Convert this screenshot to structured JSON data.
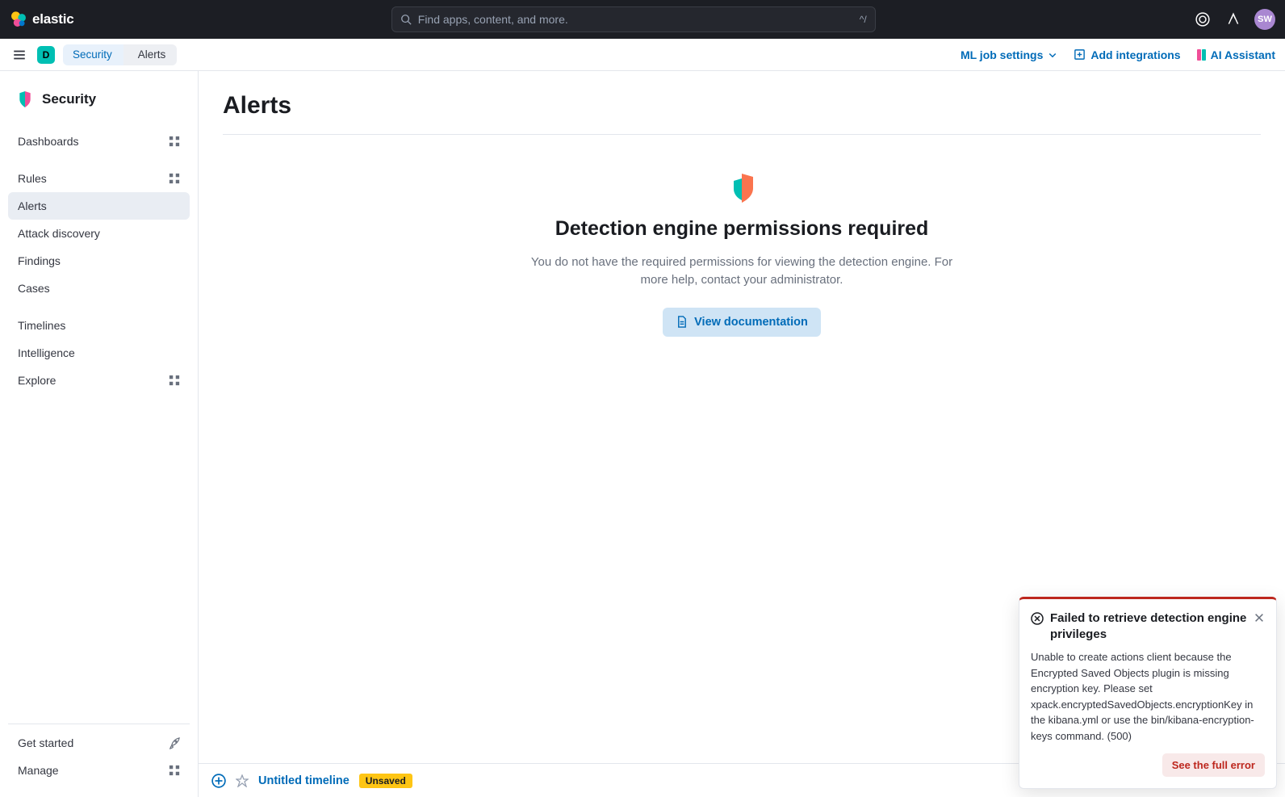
{
  "header": {
    "logo_text": "elastic",
    "search_placeholder": "Find apps, content, and more.",
    "search_shortcut": "^/",
    "avatar_initials": "SW"
  },
  "subheader": {
    "space_letter": "D",
    "breadcrumbs": {
      "security": "Security",
      "alerts": "Alerts"
    },
    "ml_job_settings": "ML job settings",
    "add_integrations": "Add integrations",
    "ai_assistant": "AI Assistant"
  },
  "sidebar": {
    "title": "Security",
    "items": {
      "dashboards": "Dashboards",
      "rules": "Rules",
      "alerts": "Alerts",
      "attack_discovery": "Attack discovery",
      "findings": "Findings",
      "cases": "Cases",
      "timelines": "Timelines",
      "intelligence": "Intelligence",
      "explore": "Explore"
    },
    "bottom": {
      "get_started": "Get started",
      "manage": "Manage"
    }
  },
  "main": {
    "page_title": "Alerts",
    "empty_title": "Detection engine permissions required",
    "empty_text": "You do not have the required permissions for viewing the detection engine. For more help, contact your administrator.",
    "doc_button": "View documentation"
  },
  "timeline": {
    "title": "Untitled timeline",
    "badge": "Unsaved"
  },
  "toast": {
    "title": "Failed to retrieve detection engine privileges",
    "body": "Unable to create actions client because the Encrypted Saved Objects plugin is missing encryption key. Please set xpack.encryptedSavedObjects.encryptionKey in the kibana.yml or use the bin/kibana-encryption-keys command. (500)",
    "button": "See the full error"
  }
}
